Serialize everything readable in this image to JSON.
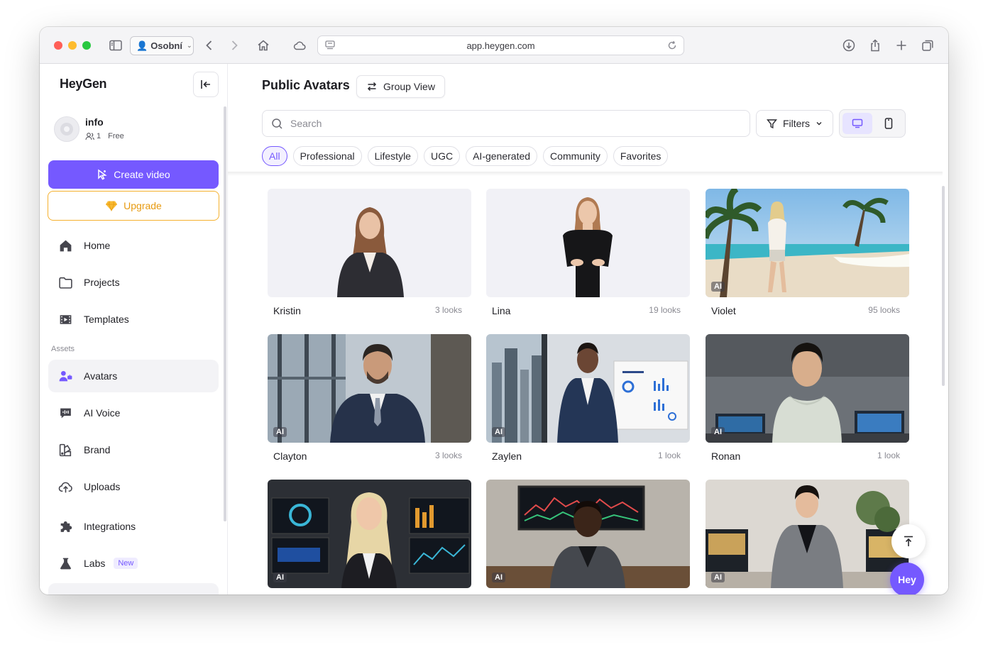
{
  "browser": {
    "profile_label": "Osobní",
    "url": "app.heygen.com"
  },
  "sidebar": {
    "logo": "HeyGen",
    "account": {
      "name": "info",
      "members": "1",
      "plan": "Free"
    },
    "create_label": "Create video",
    "upgrade_label": "Upgrade",
    "items_top": [
      {
        "label": "Home",
        "icon": "home-icon"
      },
      {
        "label": "Projects",
        "icon": "folder-icon"
      },
      {
        "label": "Templates",
        "icon": "film-icon"
      }
    ],
    "section_label": "Assets",
    "items_assets": [
      {
        "label": "Avatars",
        "icon": "avatar-icon",
        "active": true
      },
      {
        "label": "AI Voice",
        "icon": "voice-icon"
      },
      {
        "label": "Brand",
        "icon": "brand-icon"
      },
      {
        "label": "Uploads",
        "icon": "upload-icon"
      },
      {
        "label": "Integrations",
        "icon": "puzzle-icon"
      },
      {
        "label": "Labs",
        "icon": "flask-icon",
        "badge": "New"
      }
    ]
  },
  "main": {
    "title": "Public Avatars",
    "group_view_label": "Group View",
    "search_placeholder": "Search",
    "filters_label": "Filters",
    "chips": [
      "All",
      "Professional",
      "Lifestyle",
      "UGC",
      "AI-generated",
      "Community",
      "Favorites"
    ],
    "active_chip": "All",
    "ai_tag": "AI",
    "avatars": [
      {
        "name": "Kristin",
        "looks": "3 looks",
        "ai": false
      },
      {
        "name": "Lina",
        "looks": "19 looks",
        "ai": false
      },
      {
        "name": "Violet",
        "looks": "95 looks",
        "ai": true
      },
      {
        "name": "Clayton",
        "looks": "3 looks",
        "ai": true
      },
      {
        "name": "Zaylen",
        "looks": "1 look",
        "ai": true
      },
      {
        "name": "Ronan",
        "looks": "1 look",
        "ai": true
      },
      {
        "name": "",
        "looks": "",
        "ai": true
      },
      {
        "name": "",
        "looks": "",
        "ai": true
      },
      {
        "name": "",
        "looks": "",
        "ai": true
      }
    ],
    "fab_label": "Hey",
    "colors": {
      "accent": "#7559ff",
      "upgrade": "#f5b12f"
    }
  }
}
